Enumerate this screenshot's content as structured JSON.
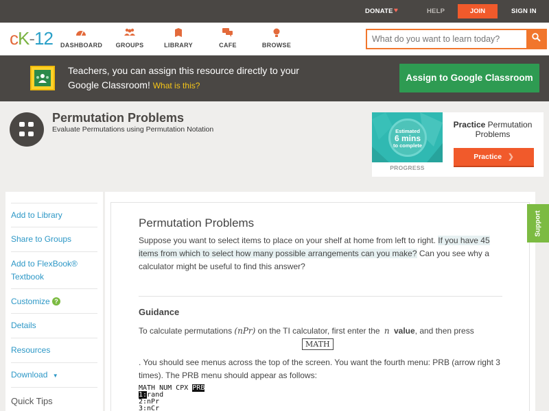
{
  "topbar": {
    "donate": "DONATE",
    "heart": "♥",
    "help": "HELP",
    "join": "JOIN",
    "signin": "SIGN IN"
  },
  "nav": {
    "logo": {
      "c": "c",
      "k": "K",
      "dash": "-",
      "num": "12"
    },
    "items": [
      {
        "label": "DASHBOARD",
        "icon": "dashboard-icon"
      },
      {
        "label": "GROUPS",
        "icon": "groups-icon"
      },
      {
        "label": "LIBRARY",
        "icon": "library-icon"
      },
      {
        "label": "CAFE",
        "icon": "cafe-icon"
      },
      {
        "label": "BROWSE",
        "icon": "browse-icon"
      }
    ],
    "search_placeholder": "What do you want to learn today?"
  },
  "google_banner": {
    "text": "Teachers, you can assign this resource directly to your Google Classroom!",
    "what": "What is this?",
    "button": "Assign to Google Classroom"
  },
  "header": {
    "title": "Permutation Problems",
    "subtitle": "Evaluate Permutations using Permutation Notation"
  },
  "practice_card": {
    "estimated": "Estimated",
    "mins": "6 mins",
    "complete": "to complete",
    "progress": "PROGRESS",
    "title_bold": "Practice",
    "title_rest": "Permutation Problems",
    "button": "Practice"
  },
  "sidebar": {
    "items": [
      "Add to Library",
      "Share to Groups",
      "Add to FlexBook® Textbook",
      "Customize",
      "Details",
      "Resources",
      "Download",
      "Quick Tips"
    ]
  },
  "content": {
    "title": "Permutation Problems",
    "intro_a": "Suppose you want to select items to place on your shelf at home from left to right.",
    "intro_b": "If you have 45 items from which to select how many possible arrangements can you make?",
    "intro_c": "Can you see why a calculator might be useful to find this answer?",
    "guidance_title": "Guidance",
    "guidance_1a": "To calculate permutations",
    "guidance_npr": "(nPr)",
    "guidance_1b": "on the TI calculator, first enter the",
    "guidance_n": "n",
    "guidance_value": "value",
    "guidance_1c": ", and then press",
    "math_key": "MATH",
    "guidance_2": ". You should see menus across the top of the screen. You want the fourth menu: PRB (arrow right 3 times). The PRB menu should appear as follows:",
    "calc_menu": "MATH NUM CPX",
    "calc_prb": "PRB",
    "calc_l1_num": "1:",
    "calc_l1": "rand",
    "calc_l2": "2:nPr",
    "calc_l3": "3:nCr"
  },
  "support": "Support",
  "colors": {
    "accent": "#f15a2b",
    "google_green": "#2e9b52",
    "link": "#2c97c6",
    "dark": "#4a4744",
    "support_green": "#7cbb42"
  }
}
